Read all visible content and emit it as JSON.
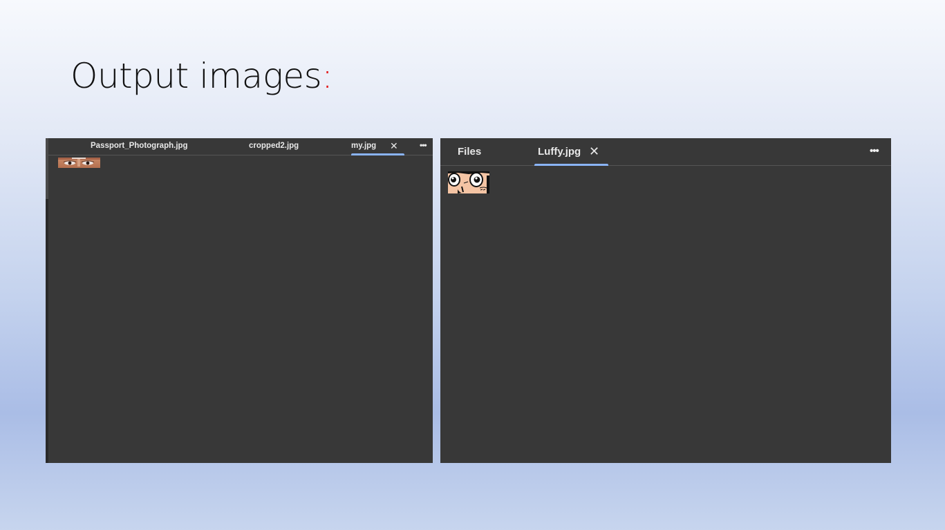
{
  "slide": {
    "title_text": "Output images",
    "title_colon": ":"
  },
  "left_panel": {
    "tabs": [
      {
        "label": "Passport_Photograph.jpg"
      },
      {
        "label": "cropped2.jpg"
      },
      {
        "label": "my.jpg",
        "active": true,
        "close_glyph": "✕"
      }
    ],
    "more_glyph": "•••",
    "image_content": "cropped eyes from passport photograph"
  },
  "right_panel": {
    "tabs": [
      {
        "label": "Files"
      },
      {
        "label": "Luffy.jpg",
        "active": true,
        "close_glyph": "✕"
      }
    ],
    "more_glyph": "•••",
    "image_content": "cropped eyes from Luffy cartoon"
  },
  "colors": {
    "panel_bg": "#383838",
    "active_tab_underline": "#8ab4f8",
    "title_accent": "#e31b1b"
  }
}
